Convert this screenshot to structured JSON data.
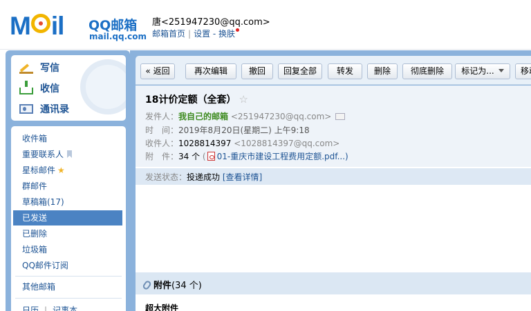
{
  "header": {
    "logo_text_m": "M",
    "logo_text_il": "il",
    "logo_title": "QQ邮箱",
    "logo_subtitle": "mail.qq.com",
    "user_display": "唐<251947230@qq.com>",
    "link_home": "邮箱首页",
    "link_settings": "设置",
    "link_skin": "换肤"
  },
  "sidebar": {
    "quick": [
      {
        "label": "写信",
        "icon": "write-icon"
      },
      {
        "label": "收信",
        "icon": "inbox-icon"
      },
      {
        "label": "通讯录",
        "icon": "contacts-icon"
      }
    ],
    "folders": [
      {
        "label": "收件箱"
      },
      {
        "label": "重要联系人"
      },
      {
        "label": "星标邮件"
      },
      {
        "label": "群邮件"
      },
      {
        "label": "草稿箱(17)"
      },
      {
        "label": "已发送",
        "active": true
      },
      {
        "label": "已删除"
      },
      {
        "label": "垃圾箱"
      },
      {
        "label": "QQ邮件订阅"
      },
      {
        "label": "其他邮箱"
      }
    ],
    "bottom_links": [
      "日历",
      "记事本"
    ]
  },
  "toolbar": {
    "back": "« 返回",
    "reedit": "再次编辑",
    "recall": "撤回",
    "reply_all": "回复全部",
    "forward": "转发",
    "delete": "删除",
    "delete_forever": "彻底删除",
    "mark_as": "标记为...",
    "move": "移动"
  },
  "mail": {
    "subject": "18计价定额（全套）",
    "sender_label": "发件人：",
    "sender_name": "我自己的邮箱",
    "sender_email": "<251947230@qq.com>",
    "time_label": "时　间：",
    "time_value": "2019年8月20日(星期二) 上午9:18",
    "recipient_label": "收件人：",
    "recipient_name": "1028814397",
    "recipient_email": "<1028814397@qq.com>",
    "attach_label": "附　件：",
    "attach_count": "34 个",
    "attach_first": "01-重庆市建设工程费用定额.pdf...)",
    "status_label": "发送状态：",
    "status_value": "投递成功",
    "status_link": "[查看详情]",
    "attach_section_title": "附件",
    "attach_section_count": "(34 个)",
    "super_attach": "超大附件"
  },
  "colors": {
    "brand_blue": "#1b6fc5",
    "frame_blue": "#8bb2dc",
    "active_folder": "#4b83c3",
    "sender_green": "#3c8a1e"
  }
}
